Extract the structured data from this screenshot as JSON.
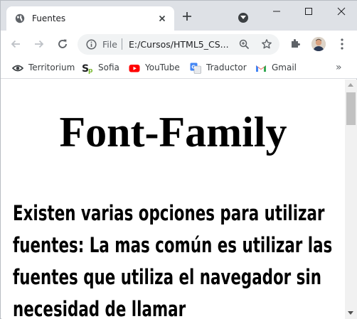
{
  "tab": {
    "title": "Fuentes"
  },
  "toolbar": {
    "url_scheme": "File",
    "url": "E:/Cursos/HTML5_CS..."
  },
  "bookmarks": [
    {
      "label": "Territorium",
      "icon": "territorium-icon"
    },
    {
      "label": "Sofia",
      "icon": "sofia-icon"
    },
    {
      "label": "YouTube",
      "icon": "youtube-icon"
    },
    {
      "label": "Traductor",
      "icon": "translate-icon"
    },
    {
      "label": "Gmail",
      "icon": "gmail-icon"
    }
  ],
  "page": {
    "heading": "Font-Family",
    "paragraph": "Existen varias opciones para utilizar fuentes: La mas común es utilizar las fuentes que utiliza el navegador sin necesidad de llamar"
  },
  "colors": {
    "tabstrip": "#dee1e6",
    "omnibox": "#f1f3f4",
    "youtube": "#ff0000",
    "gmail": "#ea4335"
  }
}
